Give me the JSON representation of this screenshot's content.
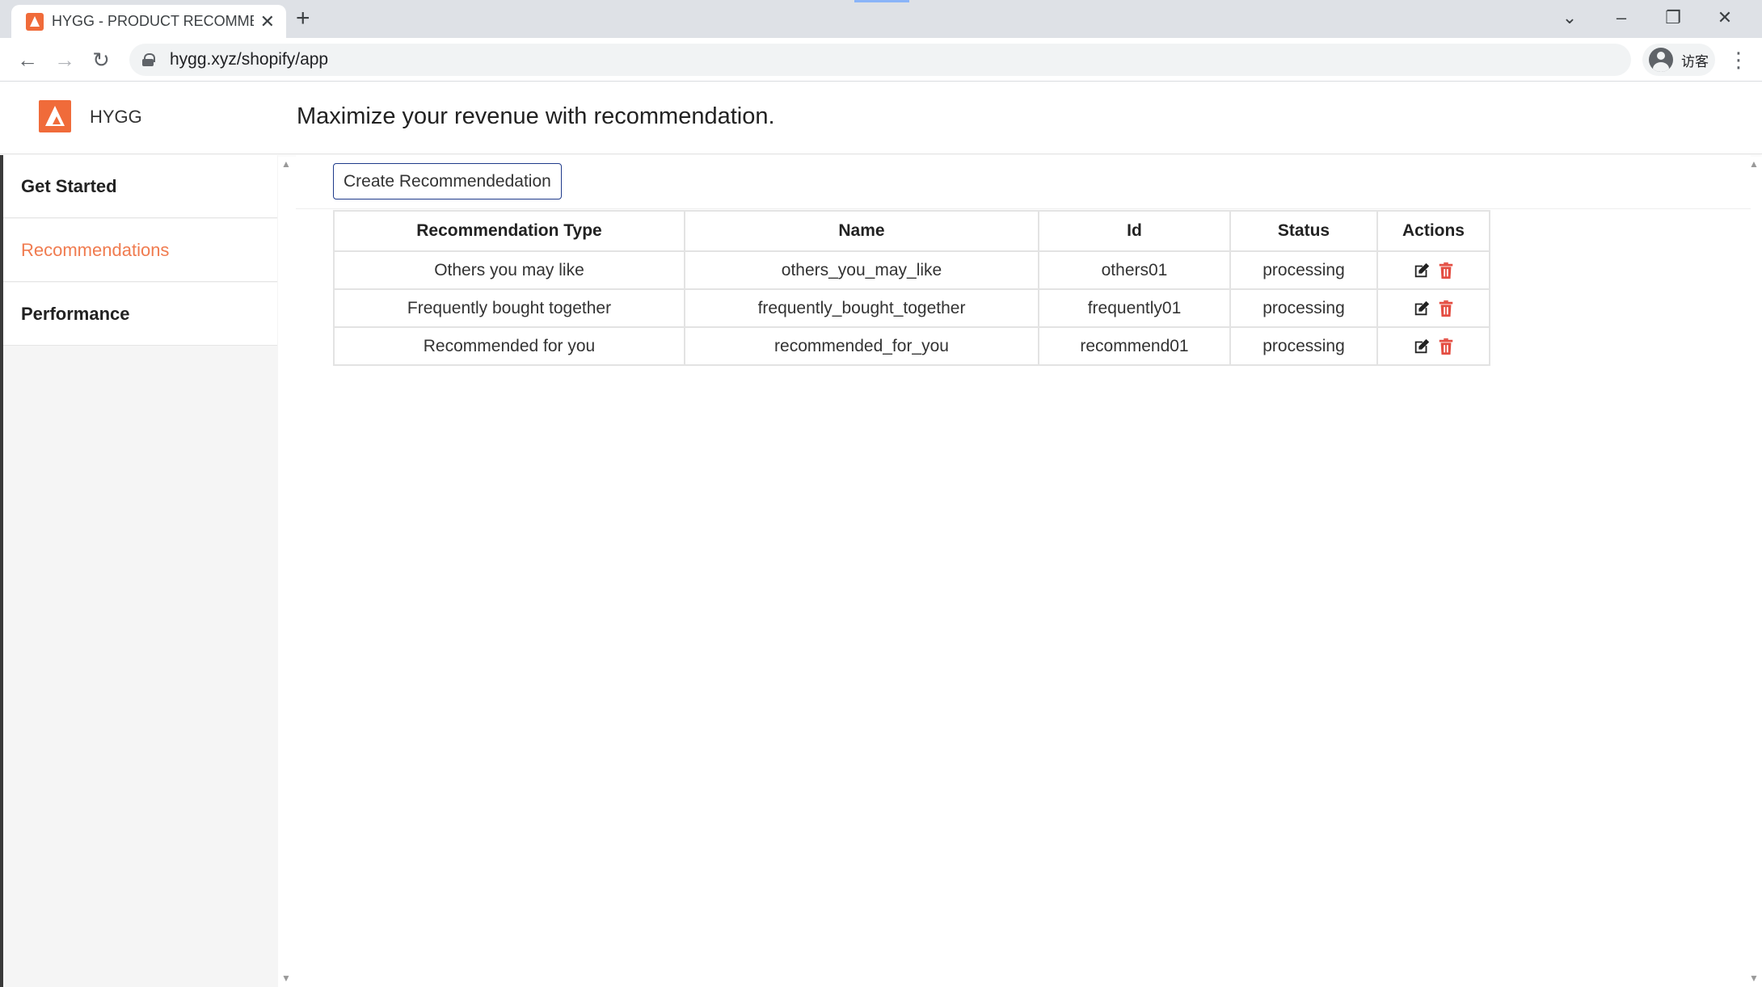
{
  "browser": {
    "tab_title": "HYGG - PRODUCT RECOMMENDATION",
    "url": "hygg.xyz/shopify/app",
    "profile_label": "访客",
    "new_tab_icon": "+",
    "tab_close_icon": "✕"
  },
  "app": {
    "brand_name": "HYGG",
    "page_title": "Maximize your revenue with recommendation.",
    "accent_color": "#f07b4f"
  },
  "sidebar": {
    "items": [
      {
        "label": "Get Started",
        "active": false
      },
      {
        "label": "Recommendations",
        "active": true
      },
      {
        "label": "Performance",
        "active": false
      }
    ]
  },
  "main": {
    "create_button_label": "Create Recommendedation",
    "table": {
      "headers": [
        "Recommendation Type",
        "Name",
        "Id",
        "Status",
        "Actions"
      ],
      "rows": [
        {
          "type": "Others you may like",
          "name": "others_you_may_like",
          "id": "others01",
          "status": "processing"
        },
        {
          "type": "Frequently bought together",
          "name": "frequently_bought_together",
          "id": "frequently01",
          "status": "processing"
        },
        {
          "type": "Recommended for you",
          "name": "recommended_for_you",
          "id": "recommend01",
          "status": "processing"
        }
      ]
    }
  }
}
